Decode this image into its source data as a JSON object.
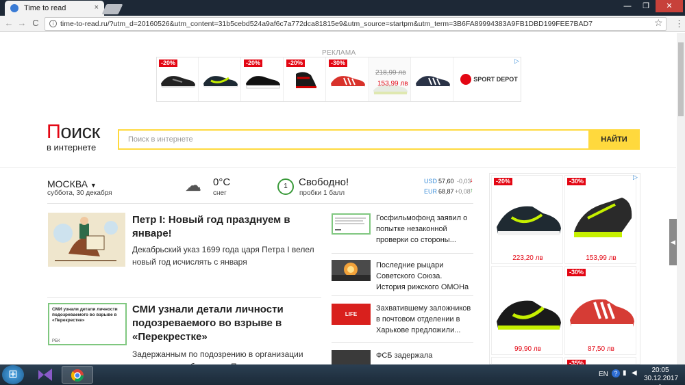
{
  "browser": {
    "tab_title": "Time to read",
    "tab_close": "×",
    "window_controls": {
      "minimize": "—",
      "maximize": "❐",
      "close": "✕"
    },
    "url": "time-to-read.ru/?utm_d=20160526&utm_content=31b5cebd524a9af6c7a772dca81815e9&utm_source=startpm&utm_term=3B6FA89994383A9FB1DBD199FEE7BAD7",
    "nav": {
      "back": "←",
      "forward": "→",
      "reload": "C"
    }
  },
  "ad_banner": {
    "label": "РЕКЛАМА",
    "items": [
      {
        "discount": "-20%"
      },
      {
        "discount": ""
      },
      {
        "discount": "-20%"
      },
      {
        "discount": "-20%"
      },
      {
        "discount": "-30%"
      },
      {
        "discount": ""
      },
      {
        "discount": ""
      }
    ],
    "old_price": "218,99 лв",
    "new_price": "153,99 лв",
    "brand": "SPORT DEPOT"
  },
  "search": {
    "logo_main": "Поиск",
    "logo_sub": "в интернете",
    "placeholder": "Поиск в интернете",
    "button": "НАЙТИ"
  },
  "info": {
    "city": "МОСКВА",
    "date": "суббота, 30 декабря",
    "temperature": "0°C",
    "weather": "снег",
    "traffic_level": "1",
    "traffic_status": "Свободно!",
    "traffic_desc": "пробки 1 балл",
    "currencies": [
      {
        "code": "USD",
        "rate": "57,60",
        "change": "-0,03",
        "dir": "↓"
      },
      {
        "code": "EUR",
        "rate": "68,87",
        "change": "+0,08",
        "dir": "↑"
      }
    ]
  },
  "news_main": [
    {
      "title": "Петр I: Новый год празднуем в январе!",
      "desc": "Декабрьский указ 1699 года царя Петра I велел новый год исчислять с января"
    },
    {
      "title": "СМИ узнали детали личности подозреваемого во взрыве в «Перекрестке»",
      "desc": "Задержанным по подозрению в организации взрыва в петербургском «Перекрестке»",
      "img_text": "СМИ узнали детали личности подозреваемого во взрыве в «Перекрестке»",
      "img_source": "РБК"
    }
  ],
  "news_side": [
    {
      "text": "Госфильмофонд заявил о попытке незаконной проверки со стороны..."
    },
    {
      "text": "Последние рыцари Советского Союза. История рижского ОМОНа"
    },
    {
      "text": "Захватившему заложников в почтовом отделении в Харькове предложили...",
      "img_label": "LIFE"
    },
    {
      "text": "ФСБ задержала"
    }
  ],
  "right_ad": {
    "items": [
      {
        "discount": "-20%",
        "price": "223,20 лв"
      },
      {
        "discount": "-30%",
        "price": "153,99 лв"
      },
      {
        "discount": "",
        "price": "99,90 лв"
      },
      {
        "discount": "-30%",
        "price": "87,50 лв"
      }
    ],
    "bottom_discount": "-35%",
    "adchoices": "▷"
  },
  "taskbar": {
    "lang": "EN",
    "time": "20:05",
    "date": "30.12.2017 г."
  }
}
